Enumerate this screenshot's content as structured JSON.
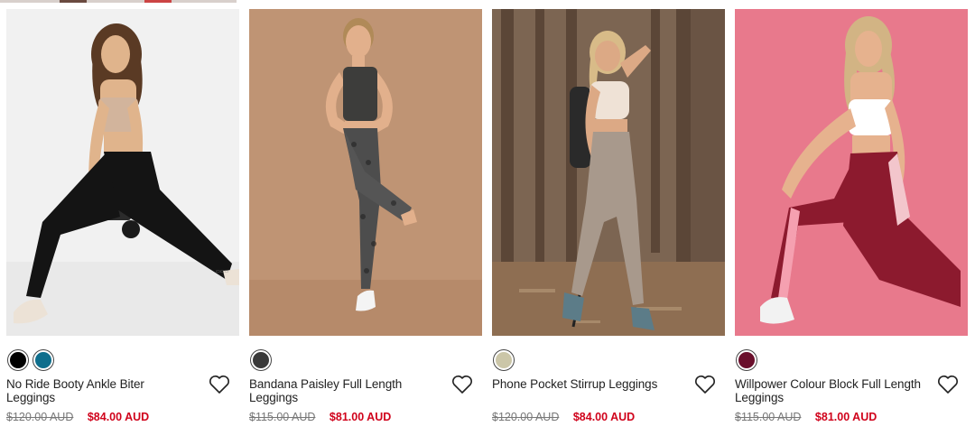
{
  "products": [
    {
      "name": "No Ride Booty Ankle Biter Leggings",
      "old_price": "$120.00 AUD",
      "sale_price": "$84.00 AUD",
      "swatches": [
        "#000000",
        "#0f6e8c"
      ],
      "image": {
        "bg": "#f1f1f1",
        "top": "#d2b49c",
        "legs": "#141414",
        "skin": "#e0b48c",
        "hair": "#5a3a24",
        "shoe": "#ece2d6"
      }
    },
    {
      "name": "Bandana Paisley Full Length Leggings",
      "old_price": "$115.00 AUD",
      "sale_price": "$81.00 AUD",
      "swatches": [
        "#3a3a3a"
      ],
      "image": {
        "bg": "#bf9474",
        "top": "#3d3d3b",
        "legs": "#4d4d4d",
        "skin": "#e2b08c",
        "hair": "#b08a58",
        "shoe": "#f4f4f4"
      }
    },
    {
      "name": "Phone Pocket Stirrup Leggings",
      "old_price": "$120.00 AUD",
      "sale_price": "$84.00 AUD",
      "swatches": [
        "#cbc6a8"
      ],
      "image": {
        "bg": "#7c6552",
        "top": "#efe2d6",
        "legs": "#a8998c",
        "skin": "#dca985",
        "hair": "#d8bb88",
        "shoe": "#5c7c88"
      }
    },
    {
      "name": "Willpower Colour Block Full Length Leggings",
      "old_price": "$115.00 AUD",
      "sale_price": "$81.00 AUD",
      "swatches": [
        "#6a0f2c"
      ],
      "image": {
        "bg": "#e8798c",
        "top": "#ffffff",
        "legs": "#8c1a2e",
        "skin": "#e6b28e",
        "hair": "#d2b484",
        "shoe": "#f2f2f2"
      }
    }
  ]
}
